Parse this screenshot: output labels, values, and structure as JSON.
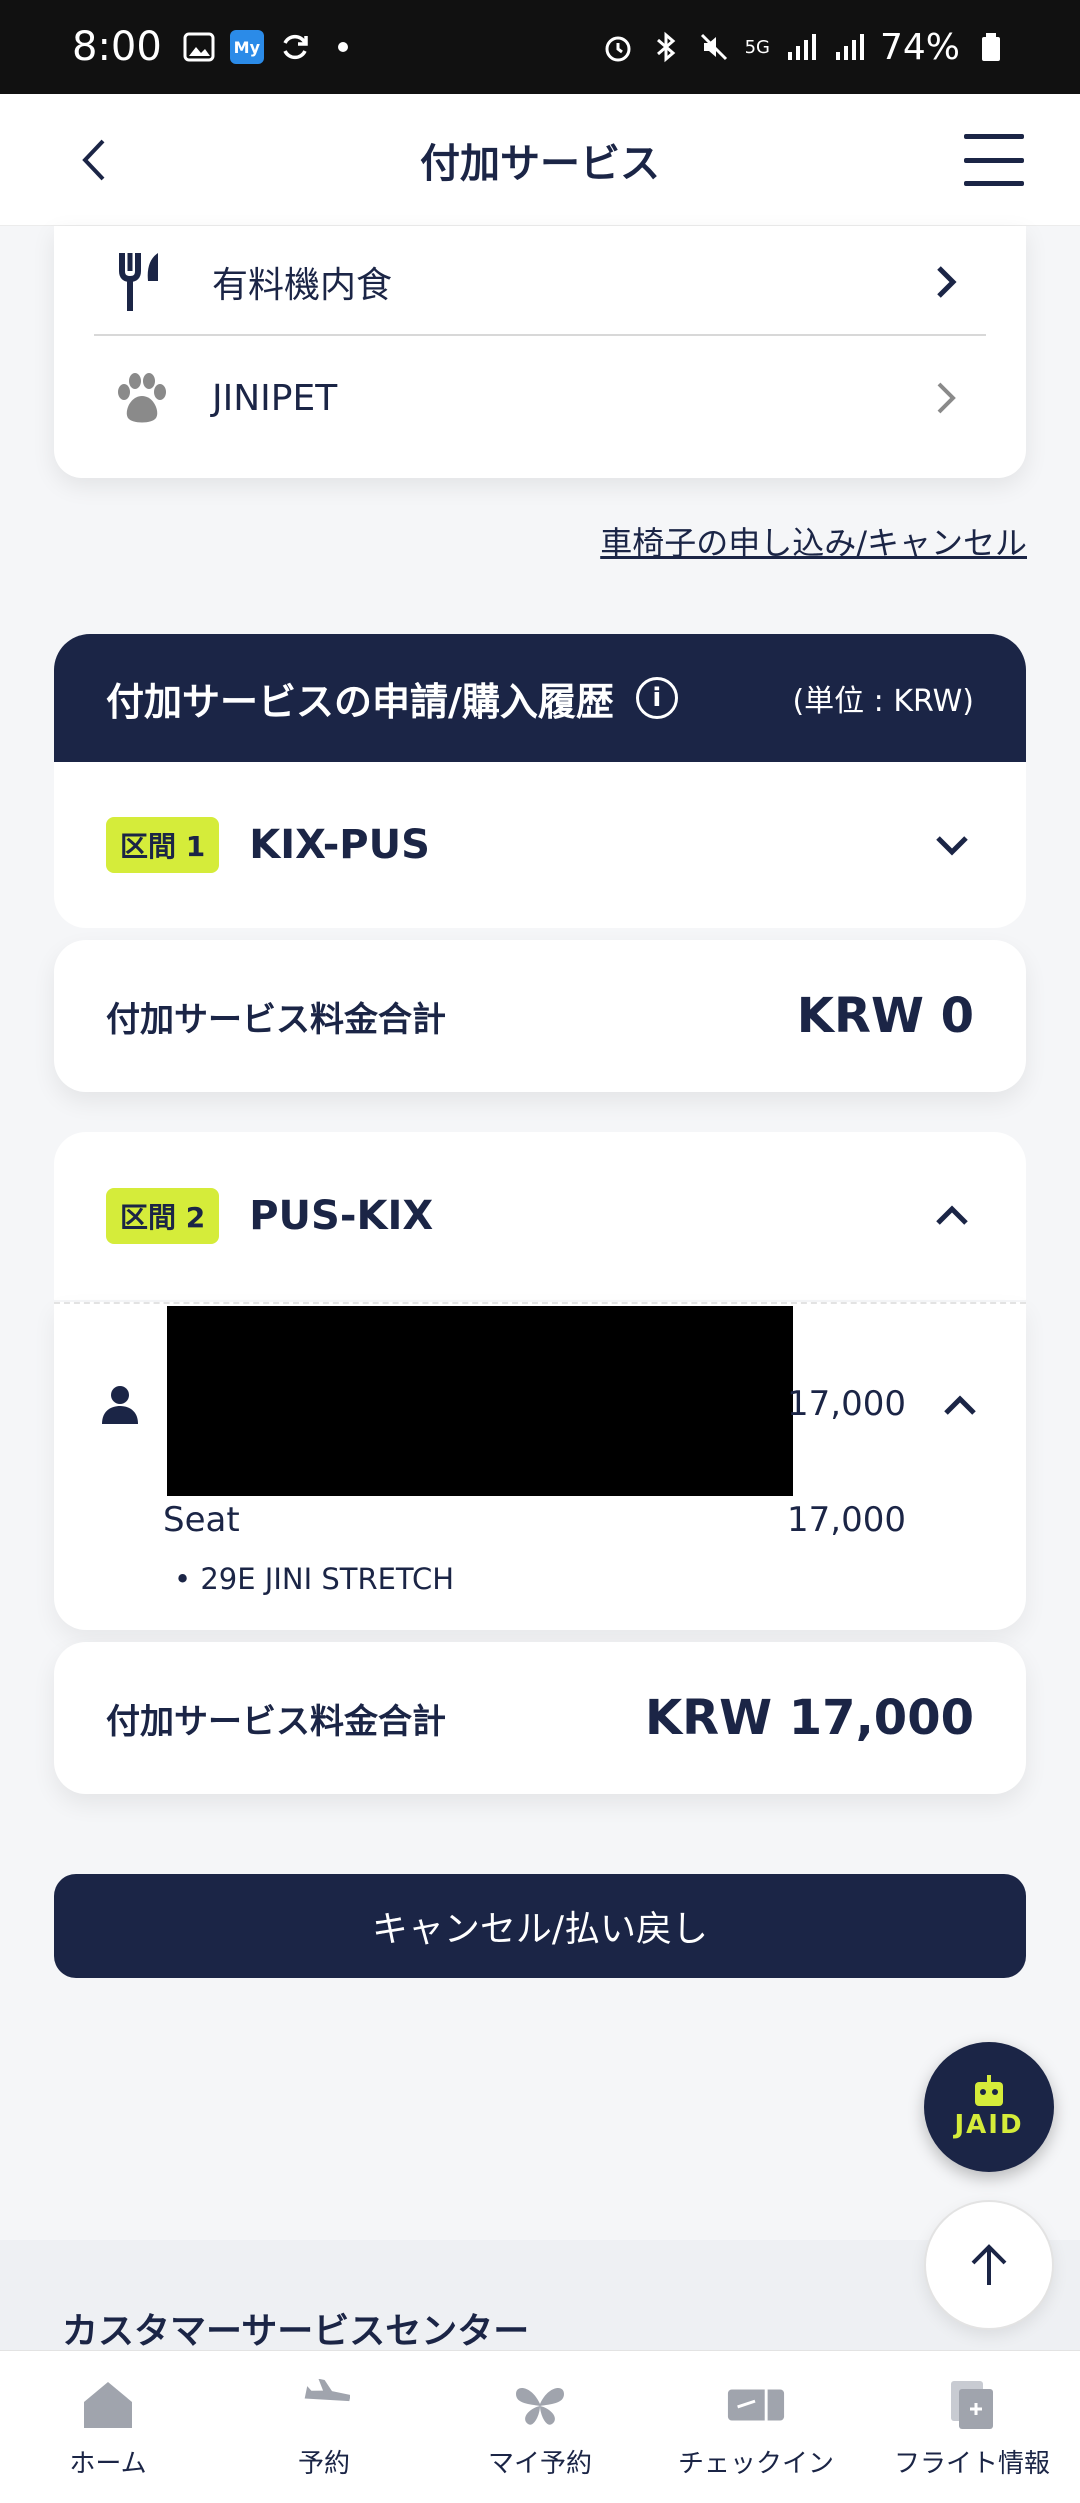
{
  "status_bar": {
    "time": "8:00",
    "battery": "74%",
    "net": "5G"
  },
  "header": {
    "title": "付加サービス"
  },
  "services": [
    {
      "label": "有料機内食",
      "icon": "fork-knife-icon"
    },
    {
      "label": "JINIPET",
      "icon": "paw-icon"
    }
  ],
  "wheelchair_link": "車椅子の申し込み/キャンセル",
  "history": {
    "title": "付加サービスの申請/購入履歴",
    "unit": "(単位 : KRW)"
  },
  "segment1": {
    "badge": "区間 1",
    "route": "KIX-PUS"
  },
  "total1": {
    "label": "付加サービス料金合計",
    "amount": "KRW 0"
  },
  "segment2": {
    "badge": "区間 2",
    "route": "PUS-KIX"
  },
  "passenger": {
    "amount": "17,000",
    "item_name": "Seat",
    "item_amount": "17,000",
    "item_detail": "• 29E JINI STRETCH"
  },
  "total2": {
    "label": "付加サービス料金合計",
    "amount": "KRW 17,000"
  },
  "cancel_button": "キャンセル/払い戻し",
  "jaid": "JAID",
  "customer_service": "カスタマーサービスセンター",
  "nav": [
    {
      "label": "ホーム",
      "icon": "home-icon"
    },
    {
      "label": "予約",
      "icon": "plane-icon"
    },
    {
      "label": "マイ予約",
      "icon": "butterfly-icon"
    },
    {
      "label": "チェックイン",
      "icon": "ticket-icon"
    },
    {
      "label": "フライト情報",
      "icon": "document-icon"
    }
  ],
  "colors": {
    "navy": "#1b2546",
    "lime": "#d5ec3a",
    "background": "#f5f6f8"
  }
}
